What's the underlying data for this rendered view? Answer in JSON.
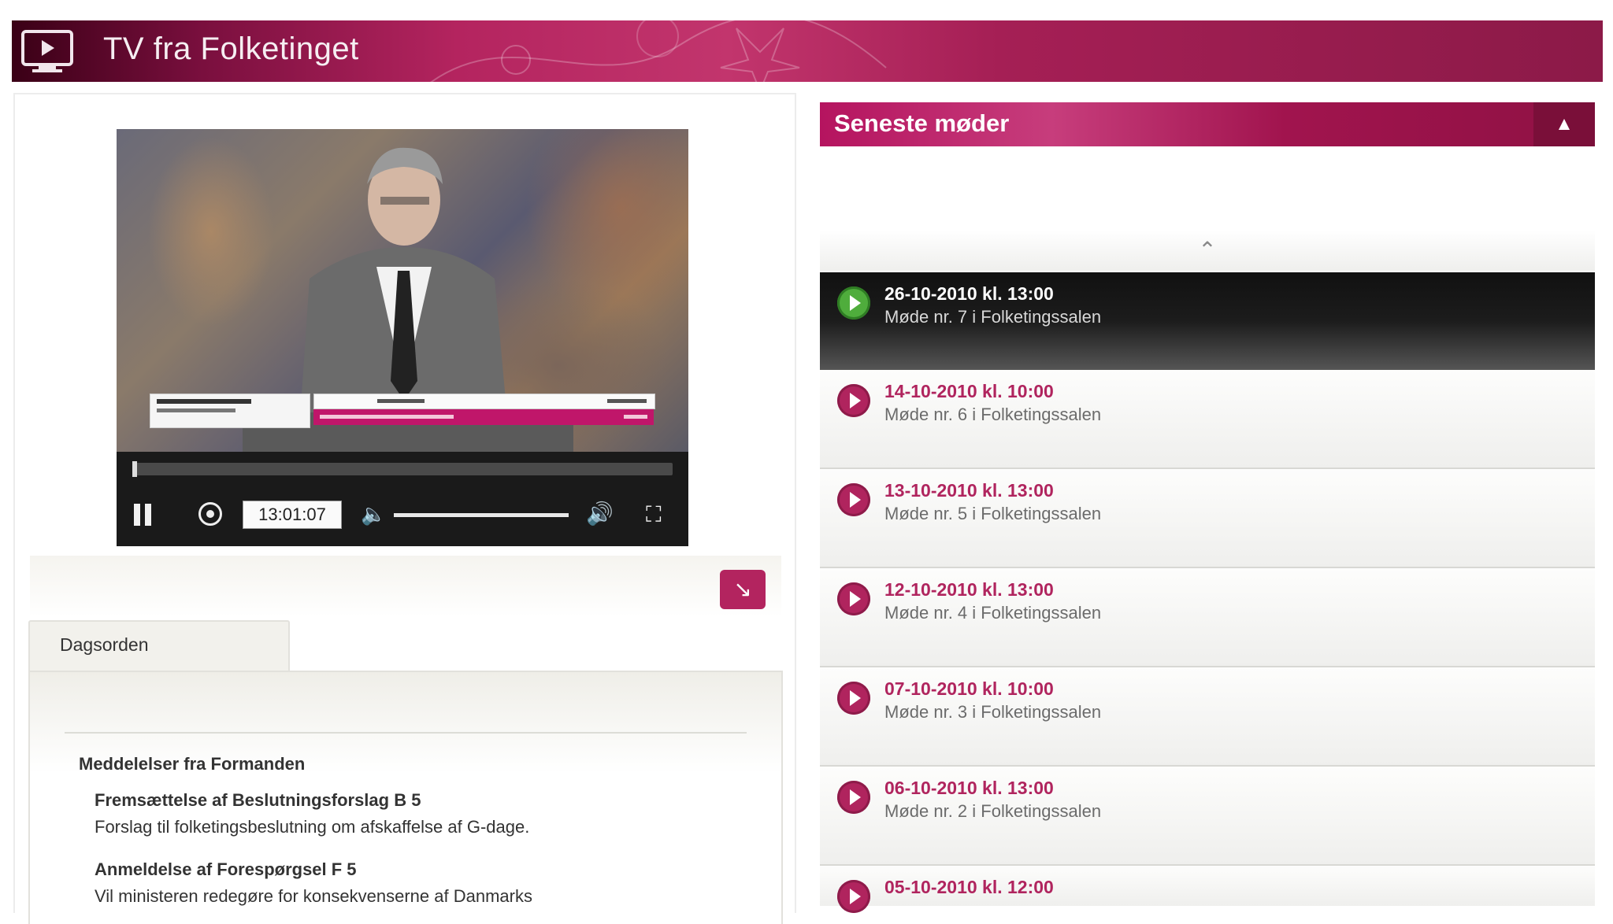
{
  "header": {
    "title": "TV fra Folketinget",
    "accent_color": "#a51f55"
  },
  "player": {
    "timecode": "13:01:07",
    "progress_fraction": 0.0,
    "volume_fraction": 0.75
  },
  "tabs": [
    {
      "label": "Dagsorden"
    }
  ],
  "agenda": {
    "heading": "Meddelelser fra Formanden",
    "items": [
      {
        "title": "Fremsættelse af Beslutningsforslag B 5",
        "text": "Forslag til folketingsbeslutning om afskaffelse af G-dage."
      },
      {
        "title": "Anmeldelse af Forespørgsel F 5",
        "text": "Vil ministeren redegøre for konsekvenserne af Danmarks"
      }
    ]
  },
  "sidebar": {
    "title": "Seneste møder",
    "meetings": [
      {
        "date": "26-10-2010 kl. 13:00",
        "desc": "Møde nr. 7 i Folketingssalen",
        "active": true
      },
      {
        "date": "14-10-2010 kl. 10:00",
        "desc": "Møde nr. 6 i Folketingssalen"
      },
      {
        "date": "13-10-2010 kl. 13:00",
        "desc": "Møde nr. 5 i Folketingssalen"
      },
      {
        "date": "12-10-2010 kl. 13:00",
        "desc": "Møde nr. 4 i Folketingssalen"
      },
      {
        "date": "07-10-2010 kl. 10:00",
        "desc": "Møde nr. 3 i Folketingssalen"
      },
      {
        "date": "06-10-2010 kl. 13:00",
        "desc": "Møde nr. 2 i Folketingssalen"
      },
      {
        "date": "05-10-2010 kl. 12:00",
        "desc": ""
      }
    ]
  }
}
